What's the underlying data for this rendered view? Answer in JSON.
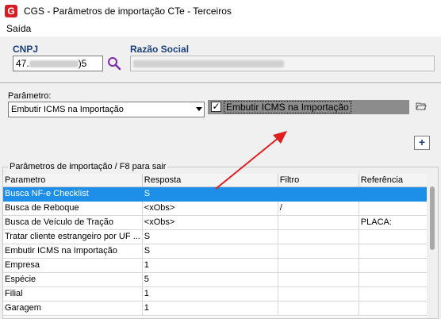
{
  "window": {
    "title": "CGS - Parâmetros de importação CTe - Terceiros",
    "icon": "G"
  },
  "menu": {
    "items": [
      "Saída"
    ]
  },
  "header": {
    "cnpj_label": "CNPJ",
    "cnpj_prefix": "47.",
    "cnpj_suffix": ")5",
    "razao_label": "Razão Social"
  },
  "parametro": {
    "label": "Parâmetro:",
    "selected": "Embutir ICMS na Importação",
    "checkbox_label": "Embutir ICMS na Importação",
    "checkbox_checked": true,
    "add_label": "+"
  },
  "grid": {
    "group_title": "Parâmetros de importação /  F8 para sair",
    "columns": [
      "Parametro",
      "Resposta",
      "Filtro",
      "Referência"
    ],
    "rows": [
      [
        "Busca NF-e Checklist",
        "S",
        "",
        ""
      ],
      [
        "Busca de Reboque",
        "<xObs>",
        "/",
        ""
      ],
      [
        "Busca de Veículo de Tração",
        "<xObs>",
        "",
        "PLACA:"
      ],
      [
        "Tratar cliente estrangeiro por UF ...",
        "S",
        "",
        ""
      ],
      [
        "Embutir ICMS na Importação",
        "S",
        "",
        ""
      ],
      [
        "Empresa",
        "1",
        "",
        ""
      ],
      [
        "Espécie",
        "5",
        "",
        ""
      ],
      [
        "Filial",
        "1",
        "",
        ""
      ],
      [
        "Garagem",
        "1",
        "",
        ""
      ]
    ],
    "selected_row": 0
  },
  "colors": {
    "selection": "#1e8fe8",
    "label_blue": "#1a3f7a",
    "arrow": "#e02020"
  },
  "icons": [
    "app-icon",
    "search-icon",
    "folder-open-icon",
    "plus-icon",
    "dropdown-arrow-icon"
  ]
}
